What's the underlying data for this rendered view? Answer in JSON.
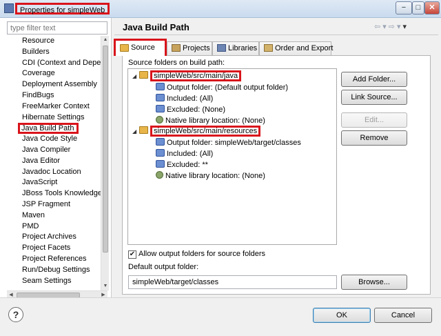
{
  "window": {
    "title": "Properties for simpleWeb",
    "controls": {
      "minimize": "−",
      "maximize": "□",
      "close": "✕"
    }
  },
  "sidebar": {
    "filter_placeholder": "type filter text",
    "items": [
      {
        "label": "Resource"
      },
      {
        "label": "Builders"
      },
      {
        "label": "CDI (Context and Deper"
      },
      {
        "label": "Coverage"
      },
      {
        "label": "Deployment Assembly"
      },
      {
        "label": "FindBugs"
      },
      {
        "label": "FreeMarker Context"
      },
      {
        "label": "Hibernate Settings"
      },
      {
        "label": "Java Build Path",
        "selected": true
      },
      {
        "label": "Java Code Style"
      },
      {
        "label": "Java Compiler"
      },
      {
        "label": "Java Editor"
      },
      {
        "label": "Javadoc Location"
      },
      {
        "label": "JavaScript"
      },
      {
        "label": "JBoss Tools Knowledge"
      },
      {
        "label": "JSP Fragment"
      },
      {
        "label": "Maven"
      },
      {
        "label": "PMD"
      },
      {
        "label": "Project Archives"
      },
      {
        "label": "Project Facets"
      },
      {
        "label": "Project References"
      },
      {
        "label": "Run/Debug Settings"
      },
      {
        "label": "Seam Settings"
      }
    ]
  },
  "page": {
    "title": "Java Build Path",
    "nav": {
      "back": "⇦",
      "forward": "⇨",
      "menu": "▾"
    }
  },
  "tabs": [
    {
      "label": "Source",
      "active": true
    },
    {
      "label": "Projects"
    },
    {
      "label": "Libraries"
    },
    {
      "label": "Order and Export"
    }
  ],
  "source": {
    "section_label": "Source folders on build path:",
    "folders": [
      {
        "label": "simpleWeb/src/main/java",
        "children": [
          "Output folder: (Default output folder)",
          "Included: (All)",
          "Excluded: (None)",
          "Native library location: (None)"
        ]
      },
      {
        "label": "simpleWeb/src/main/resources",
        "children": [
          "Output folder: simpleWeb/target/classes",
          "Included: (All)",
          "Excluded: **",
          "Native library location: (None)"
        ]
      }
    ],
    "buttons": {
      "add_folder": "Add Folder...",
      "link_source": "Link Source...",
      "edit": "Edit...",
      "remove": "Remove"
    },
    "allow_output_label": "Allow output folders for source folders",
    "allow_output_checked": true,
    "default_output_label": "Default output folder:",
    "default_output_value": "simpleWeb/target/classes",
    "browse": "Browse..."
  },
  "footer": {
    "help": "?",
    "ok": "OK",
    "cancel": "Cancel"
  },
  "colors": {
    "highlight_red": "#d9141b",
    "folder": "#e8b54a"
  }
}
